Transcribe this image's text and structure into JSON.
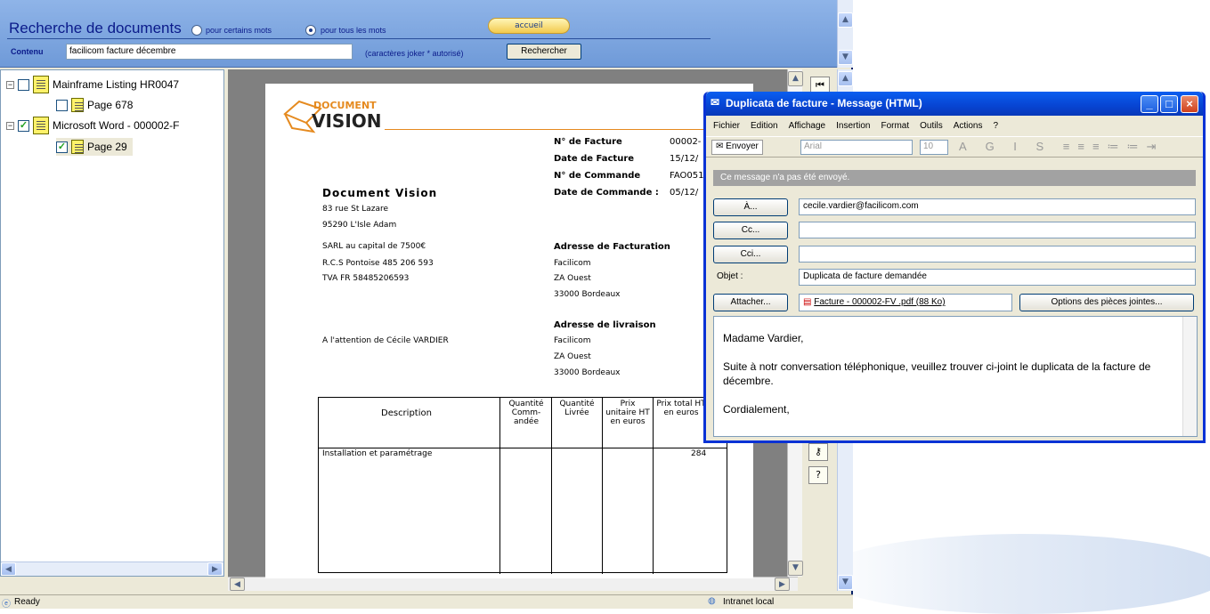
{
  "search": {
    "title": "Recherche de documents",
    "radio_some": "pour certains mots",
    "radio_all": "pour tous les mots",
    "home": "accueil",
    "content_label": "Contenu",
    "query": "facilicom facture décembre",
    "hint": "(caractères joker * autorisé)",
    "button": "Rechercher"
  },
  "tree": {
    "items": [
      {
        "label": "Mainframe Listing HR0047",
        "checked": false
      },
      {
        "label": "Page  678",
        "checked": false
      },
      {
        "label": "Microsoft Word - 000002-F",
        "checked": true
      },
      {
        "label": "Page  29",
        "checked": true
      }
    ]
  },
  "document": {
    "logo_top": "DOCUMENT",
    "logo_bottom": "VISION",
    "invoice_no_label": "N° de Facture",
    "invoice_no": "00002-",
    "invoice_date_label": "Date de Facture",
    "invoice_date": "15/12/",
    "order_no_label": "N° de Commande",
    "order_no": "FAO051",
    "order_date_label": "Date de Commande :",
    "order_date": "05/12/",
    "company": "Document Vision",
    "address1": "83 rue St Lazare",
    "address2": "95290 L'Isle Adam",
    "capital": "SARL au capital de 7500€",
    "rcs": "R.C.S Pontoise 485 206 593",
    "tva": "TVA  FR 58485206593",
    "billing_label": "Adresse de Facturation",
    "billing1": "Facilicom",
    "billing2": "ZA Ouest",
    "billing3": "33000 Bordeaux",
    "shipping_label": "Adresse de livraison",
    "attention": "A l'attention de Cécile VARDIER",
    "ship1": "Facilicom",
    "ship2": "ZA Ouest",
    "ship3": "33000 Bordeaux",
    "col_desc": "Description",
    "col_qty_ordered": "Quantité Comm-andée",
    "col_qty_delivered": "Quantité Livrée",
    "col_unit_price": "Prix unitaire HT en euros",
    "col_total": "Prix total HT en euros",
    "row_desc": "Installation et paramétrage",
    "row_total": "284"
  },
  "status": {
    "left": "Ready",
    "zone": "Intranet local"
  },
  "mail": {
    "title": "Duplicata de facture  - Message (HTML)",
    "menu": [
      "Fichier",
      "Edition",
      "Affichage",
      "Insertion",
      "Format",
      "Outils",
      "Actions",
      "?"
    ],
    "send": "Envoyer",
    "font": "Arial",
    "size": "10",
    "notice": "Ce message n'a pas été envoyé.",
    "to_btn": "À...",
    "to": "cecile.vardier@facilicom.com",
    "cc_btn": "Cc...",
    "bcc_btn": "Cci...",
    "subject_label": "Objet :",
    "subject": "Duplicata de facture demandée",
    "attach_btn": "Attacher...",
    "attachment": "Facture - 000002-FV .pdf (88 Ko)",
    "attach_options": "Options des pièces jointes...",
    "body_greeting": "Madame Vardier,",
    "body_text": "Suite à notr conversation téléphonique, veuillez trouver ci-joint le duplicata de la facture de décembre.",
    "body_closing": "Cordialement,"
  }
}
